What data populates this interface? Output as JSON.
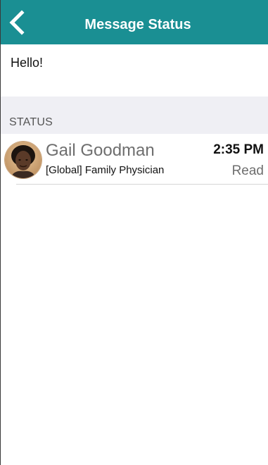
{
  "header": {
    "title": "Message Status",
    "back_icon": "chevron-left-icon",
    "background_color": "#1a8f93"
  },
  "message": {
    "text": "Hello!"
  },
  "status_section": {
    "label": "STATUS",
    "recipients": [
      {
        "name": "Gail Goodman",
        "role": "[Global] Family Physician",
        "time": "2:35 PM",
        "status": "Read",
        "avatar": "profile-photo"
      }
    ]
  }
}
